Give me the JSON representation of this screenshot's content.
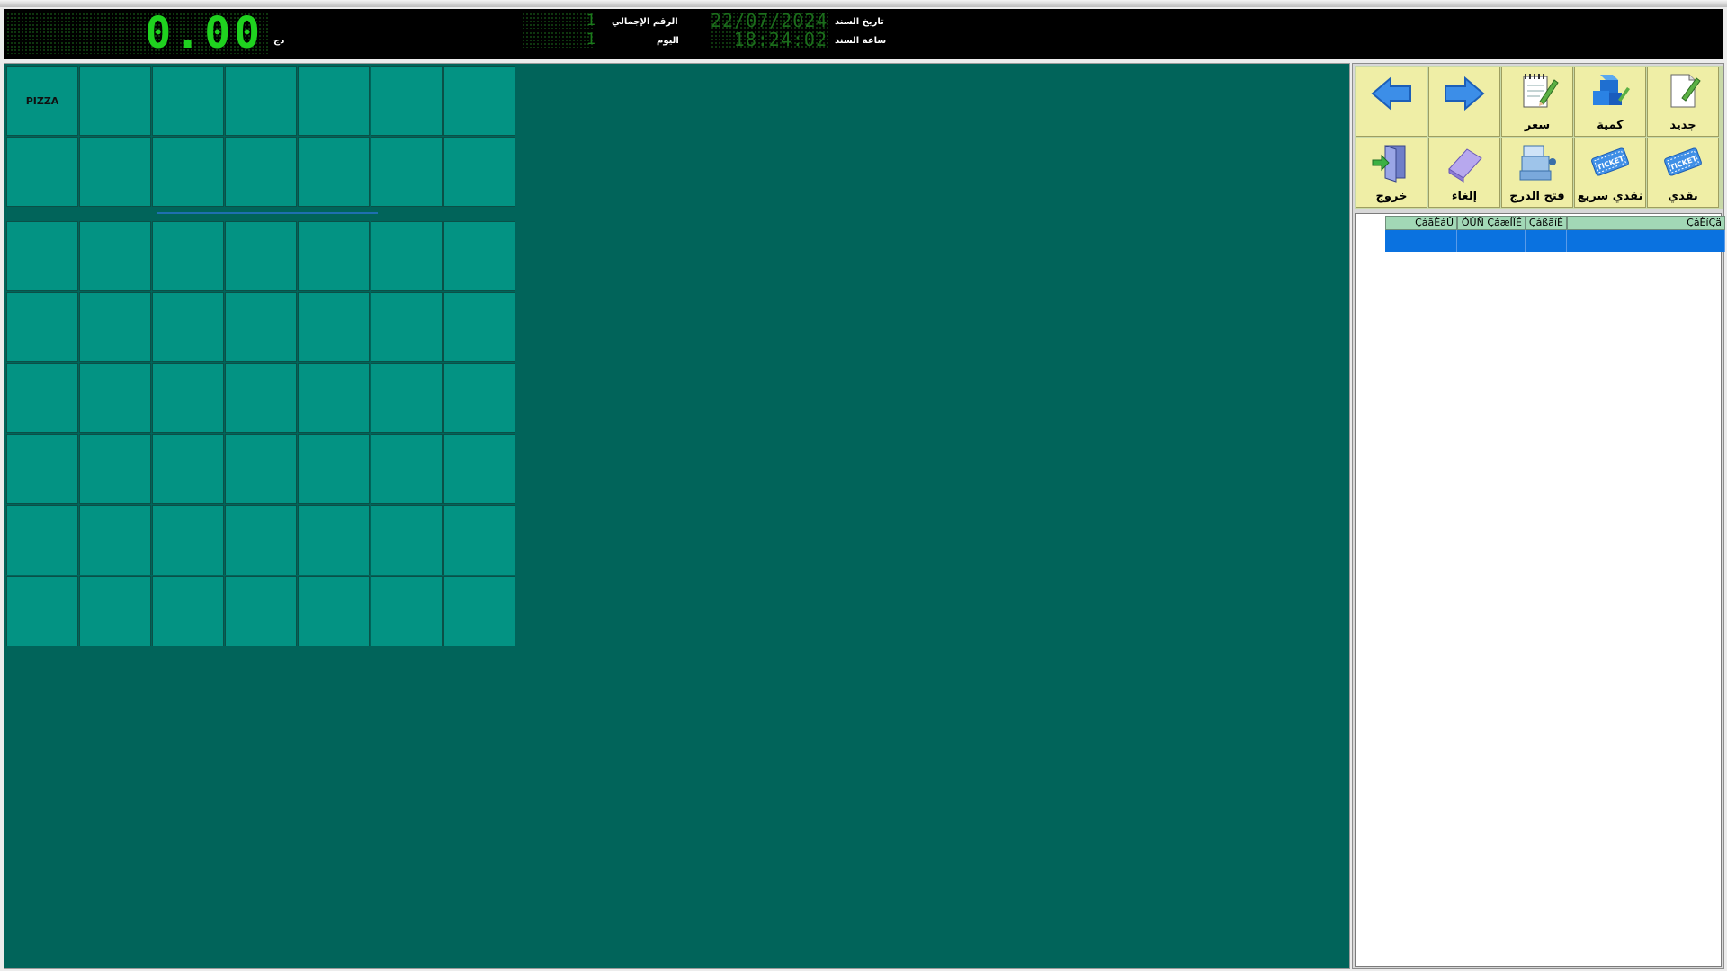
{
  "header": {
    "total": "0.00",
    "currency": "دج",
    "grand_number_label": "الرقم الإجمالي",
    "grand_number": "1",
    "day_label": "اليوم",
    "day_number": "1",
    "doc_date_label": "تاريخ السند",
    "doc_date": "22/07/2024",
    "doc_time_label": "ساعة السند",
    "doc_time": "18:24:02"
  },
  "categories": [
    "PIZZA",
    "",
    "",
    "",
    "",
    "",
    "",
    "",
    "",
    "",
    "",
    "",
    "",
    ""
  ],
  "products": {
    "rows": 6,
    "columns": 7
  },
  "toolbar": {
    "row1": [
      {
        "name": "prev-button",
        "icon": "arrow-left-icon",
        "label": ""
      },
      {
        "name": "next-button",
        "icon": "arrow-right-icon",
        "label": ""
      },
      {
        "name": "price-button",
        "icon": "notepad-pencil-icon",
        "label": "سعر"
      },
      {
        "name": "quantity-button",
        "icon": "blocks-icon",
        "label": "كمية"
      },
      {
        "name": "new-button",
        "icon": "new-document-icon",
        "label": "جديد"
      }
    ],
    "row2": [
      {
        "name": "exit-button",
        "icon": "door-exit-icon",
        "label": "خروج"
      },
      {
        "name": "cancel-button",
        "icon": "eraser-icon",
        "label": "إلغاء"
      },
      {
        "name": "open-drawer-button",
        "icon": "cash-register-icon",
        "label": "فتح الدرج"
      },
      {
        "name": "quick-cash-button",
        "icon": "ticket-icon",
        "label": "نقدي سريع"
      },
      {
        "name": "cash-button",
        "icon": "ticket-icon",
        "label": "نقدي"
      }
    ]
  },
  "table": {
    "columns": [
      "ÇáãÈáÛ",
      "ÓÚÑ ÇáæÍÏÉ",
      "ÇáßãíÉ",
      "ÇáÈíÇä"
    ]
  },
  "colors": {
    "panel_bg": "#01645a",
    "cell_bg": "#039383",
    "lcd_green": "#1fd21f",
    "toolbar_bg": "#efeea6",
    "selected_row": "#0a72e0"
  }
}
